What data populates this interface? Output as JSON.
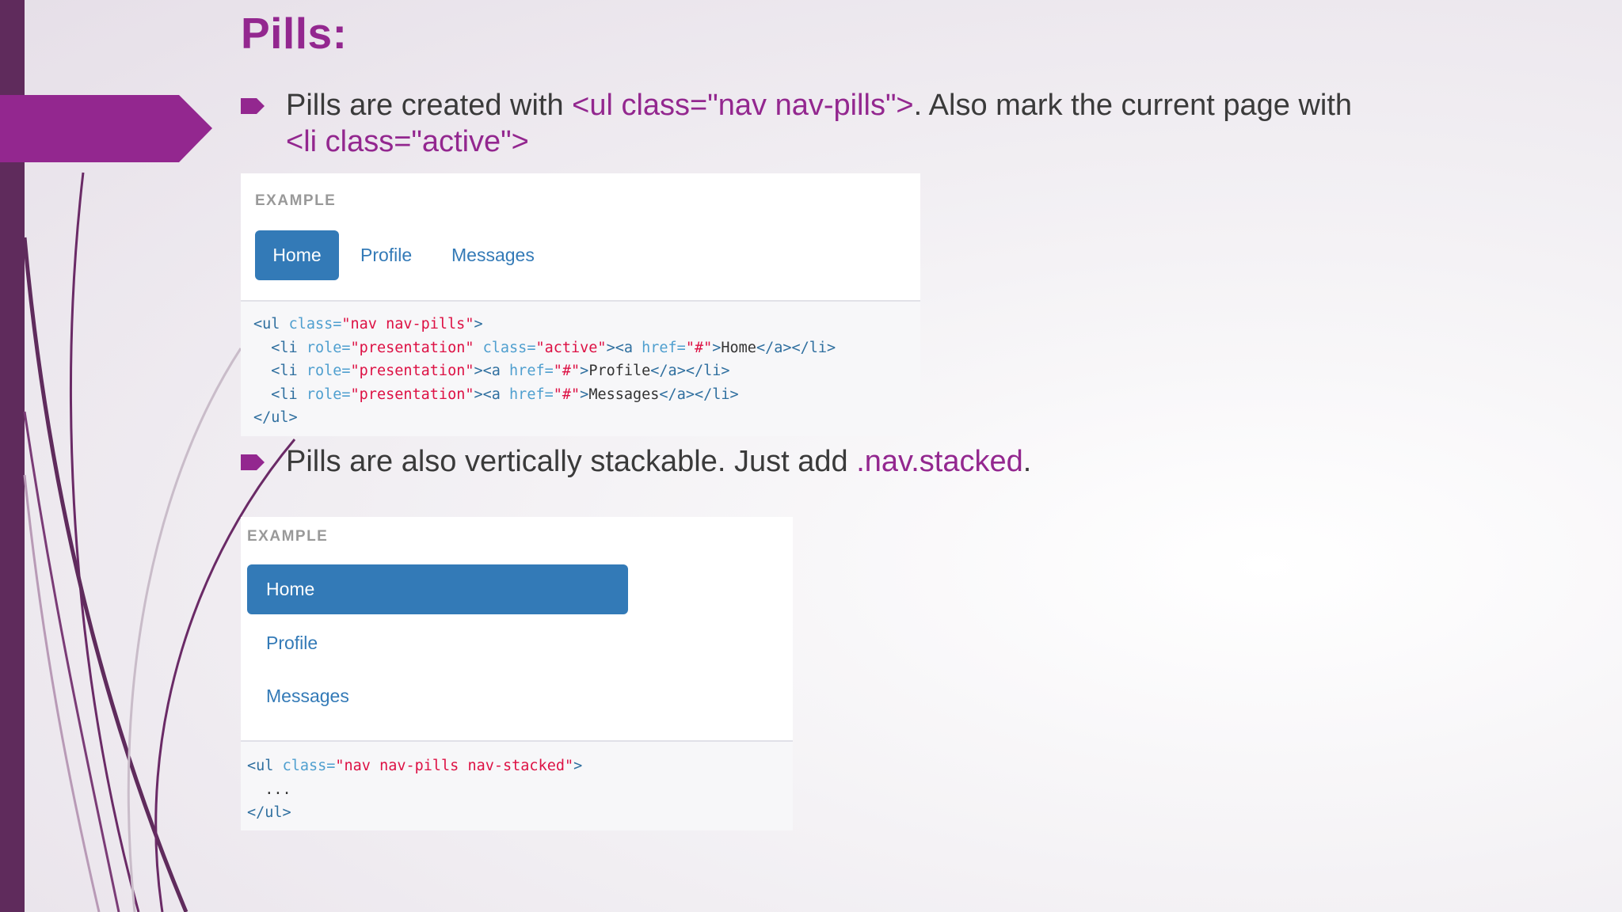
{
  "slide": {
    "title": "Pills:",
    "colors": {
      "accent": "#93278f",
      "pill_active": "#337ab7",
      "left_bar": "#5f2b5c"
    }
  },
  "bullets": [
    {
      "icon": "bullet-arrow-icon",
      "parts": [
        "Pills are created with ",
        "<ul class=\"nav nav-pills\">",
        ". Also mark the current page with ",
        "<li class=\"active\">"
      ]
    },
    {
      "icon": "bullet-arrow-icon",
      "parts": [
        "Pills are also vertically stackable. Just add ",
        ".nav.stacked",
        "."
      ]
    }
  ],
  "example1": {
    "label": "EXAMPLE",
    "pills": [
      {
        "label": "Home",
        "active": true
      },
      {
        "label": "Profile",
        "active": false
      },
      {
        "label": "Messages",
        "active": false
      }
    ],
    "code": [
      {
        "tag_open": "<ul ",
        "attr1": "class=",
        "val1": "\"nav nav-pills\"",
        "tag_close": ">"
      },
      {
        "indent": "  ",
        "tag_open": "<li ",
        "attr1": "role=",
        "val1": "\"presentation\"",
        "sp": " ",
        "attr2": "class=",
        "val2": "\"active\"",
        "tag_mid": "><a ",
        "attr3": "href=",
        "val3": "\"#\"",
        "tag_close": ">",
        "text": "Home",
        "tag_end": "</a></li>"
      },
      {
        "indent": "  ",
        "tag_open": "<li ",
        "attr1": "role=",
        "val1": "\"presentation\"",
        "tag_mid": "><a ",
        "attr3": "href=",
        "val3": "\"#\"",
        "tag_close": ">",
        "text": "Profile",
        "tag_end": "</a></li>"
      },
      {
        "indent": "  ",
        "tag_open": "<li ",
        "attr1": "role=",
        "val1": "\"presentation\"",
        "tag_mid": "><a ",
        "attr3": "href=",
        "val3": "\"#\"",
        "tag_close": ">",
        "text": "Messages",
        "tag_end": "</a></li>"
      },
      {
        "tag_open": "</ul>"
      }
    ]
  },
  "example2": {
    "label": "EXAMPLE",
    "pills": [
      {
        "label": "Home",
        "active": true
      },
      {
        "label": "Profile",
        "active": false
      },
      {
        "label": "Messages",
        "active": false
      }
    ],
    "code": [
      {
        "tag_open": "<ul ",
        "attr1": "class=",
        "val1": "\"nav nav-pills nav-stacked\"",
        "tag_close": ">"
      },
      {
        "indent": "  ",
        "text": "..."
      },
      {
        "tag_open": "</ul>"
      }
    ]
  }
}
